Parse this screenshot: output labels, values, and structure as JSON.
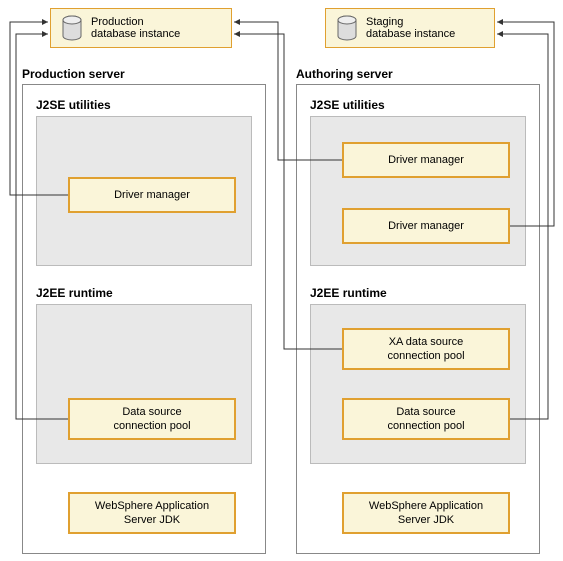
{
  "databases": {
    "production": {
      "label": "Production\ndatabase instance"
    },
    "staging": {
      "label": "Staging\ndatabase instance"
    }
  },
  "servers": {
    "production": {
      "title": "Production server",
      "j2se": {
        "title": "J2SE utilities",
        "items": [
          "Driver manager"
        ]
      },
      "j2ee": {
        "title": "J2EE runtime",
        "items": [
          "Data source\nconnection pool"
        ]
      },
      "jdk": "WebSphere Application\nServer JDK"
    },
    "authoring": {
      "title": "Authoring server",
      "j2se": {
        "title": "J2SE utilities",
        "items": [
          "Driver manager",
          "Driver manager"
        ]
      },
      "j2ee": {
        "title": "J2EE runtime",
        "items": [
          "XA data source\nconnection pool",
          "Data source\nconnection pool"
        ]
      },
      "jdk": "WebSphere Application\nServer JDK"
    }
  }
}
